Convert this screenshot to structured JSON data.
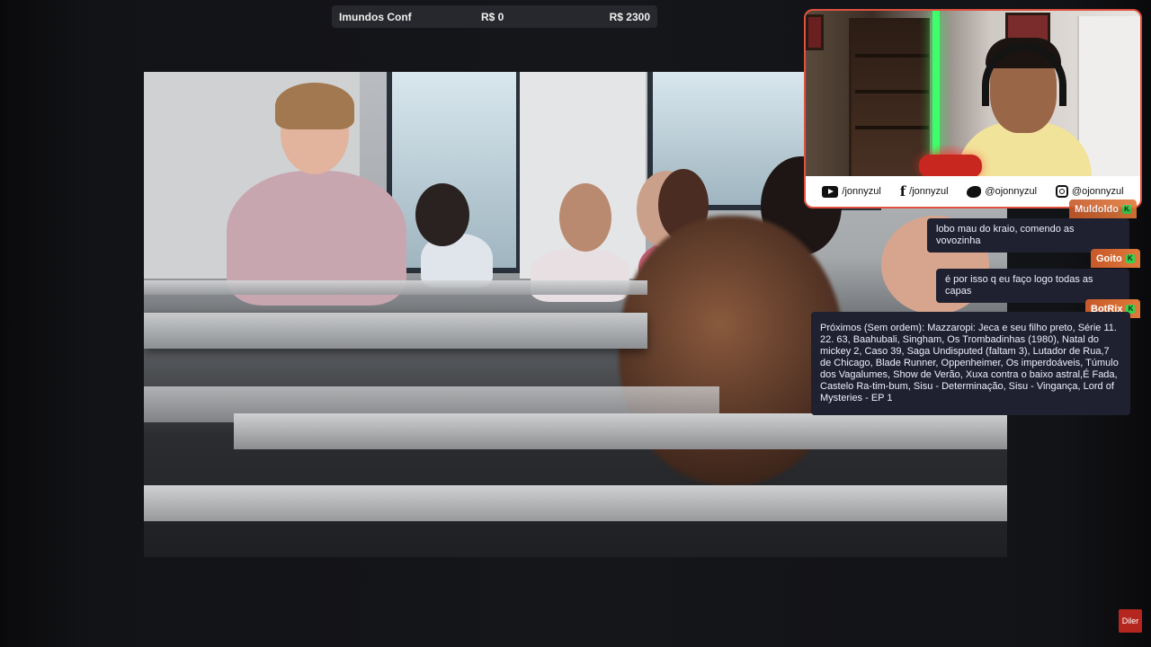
{
  "goal": {
    "title": "Imundos Conf",
    "current": "R$ 0",
    "target": "R$ 2300"
  },
  "webcam": {
    "socials": [
      {
        "icon": "youtube-icon",
        "handle": "/jonnyzul"
      },
      {
        "icon": "facebook-icon",
        "handle": "/jonnyzul"
      },
      {
        "icon": "twitter-icon",
        "handle": "@ojonnyzul"
      },
      {
        "icon": "instagram-icon",
        "handle": "@ojonnyzul"
      }
    ]
  },
  "chat": {
    "messages": [
      {
        "user": "Muldoldo",
        "text": "lobo mau do kraio, comendo as vovozinha"
      },
      {
        "user": "Goito",
        "text": "é por isso q eu faço logo todas as capas"
      },
      {
        "user": "BotRix",
        "text": "Próximos (Sem ordem): Mazzaropi: Jeca e seu filho preto, Série 11. 22. 63, Baahubali, Singham, Os Trombadinhas (1980), Natal do mickey 2, Caso 39, Saga Undisputed (faltam 3), Lutador de Rua,7 de Chicago, Blade Runner, Oppenheimer, Os imperdoáveis, Túmulo dos Vagalumes, Show de Verão, Xuxa contra o baixo astral,É Fada, Castelo Ra-tim-bum, Sisu - Determinação, Sisu - Vingança, Lord of Mysteries - EP 1"
      }
    ],
    "badge_glyph": "K"
  },
  "watermark": "Diler",
  "colors": {
    "accent": "#e0513f",
    "chat_name_bg": "#d4672f",
    "chat_bubble": "#1f2130",
    "badge": "#38d14f"
  }
}
